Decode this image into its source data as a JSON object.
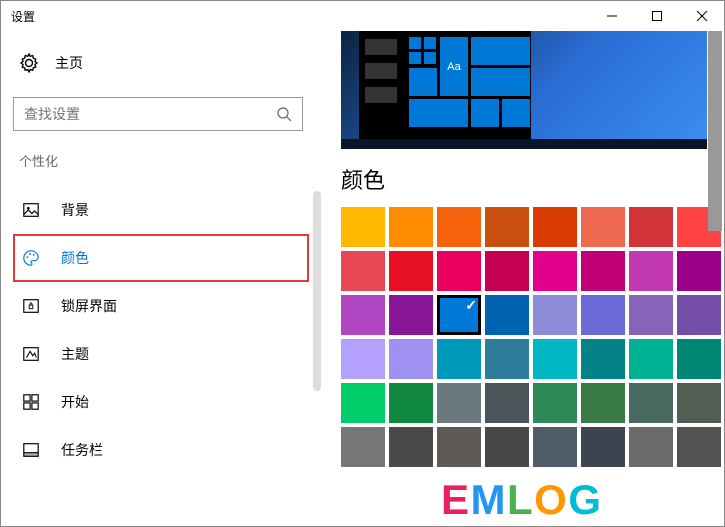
{
  "window": {
    "title": "设置"
  },
  "sidebar": {
    "home_label": "主页",
    "search_placeholder": "查找设置",
    "section_header": "个性化",
    "items": [
      {
        "label": "背景",
        "icon": "picture-icon"
      },
      {
        "label": "颜色",
        "icon": "palette-icon"
      },
      {
        "label": "锁屏界面",
        "icon": "lockscreen-icon"
      },
      {
        "label": "主题",
        "icon": "theme-icon"
      },
      {
        "label": "开始",
        "icon": "start-icon"
      },
      {
        "label": "任务栏",
        "icon": "taskbar-icon"
      }
    ],
    "active_index": 1
  },
  "main": {
    "section_title": "颜色",
    "preview_tile_text": "Aa",
    "selected_color_index": 18,
    "colors": [
      "#ffb900",
      "#ff8c00",
      "#f7630c",
      "#ca5010",
      "#da3b01",
      "#ef6950",
      "#d13438",
      "#ff4343",
      "#e74856",
      "#e81123",
      "#ea005e",
      "#c30052",
      "#e3008c",
      "#bf0077",
      "#c239b3",
      "#9a0089",
      "#b146c2",
      "#881798",
      "#0078d7",
      "#0063b1",
      "#8e8cd8",
      "#6b69d6",
      "#8764b8",
      "#744da9",
      "#b4a0ff",
      "#9e91f2",
      "#0099bc",
      "#2d7d9a",
      "#00b7c3",
      "#038387",
      "#00b294",
      "#018574",
      "#00cc6a",
      "#10893e",
      "#69797e",
      "#4a5459",
      "#2e8b57",
      "#3a7a47",
      "#486860",
      "#525e54",
      "#767676",
      "#4c4a48",
      "#5d5a58",
      "#4a4846",
      "#515c6b",
      "#3b444f",
      "#6b6b6b",
      "#525252"
    ]
  },
  "overlay": {
    "text": "EMLOG"
  }
}
